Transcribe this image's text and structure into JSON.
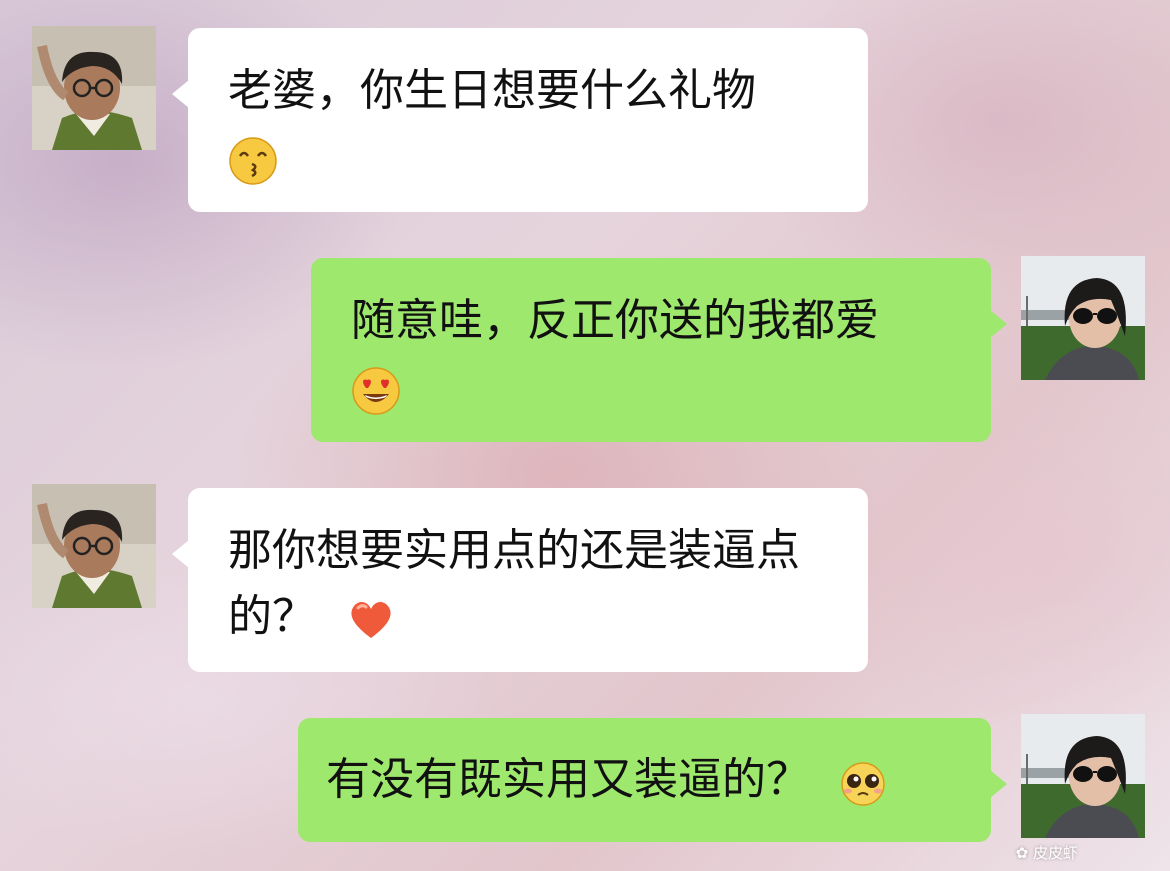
{
  "messages": [
    {
      "side": "left",
      "text": "老婆，你生日想要什么礼物",
      "emoji": "kissing-face"
    },
    {
      "side": "right",
      "text": "随意哇，反正你送的我都爱",
      "emoji": "heart-eyes-face"
    },
    {
      "side": "left",
      "text": "那你想要实用点的还是装逼点的？",
      "emoji": "orange-heart"
    },
    {
      "side": "right",
      "text": "有没有既实用又装逼的？",
      "emoji": "pleading-face"
    }
  ],
  "watermark": "皮皮虾",
  "colors": {
    "sent_bubble": "#9fe86e",
    "received_bubble": "#ffffff"
  }
}
